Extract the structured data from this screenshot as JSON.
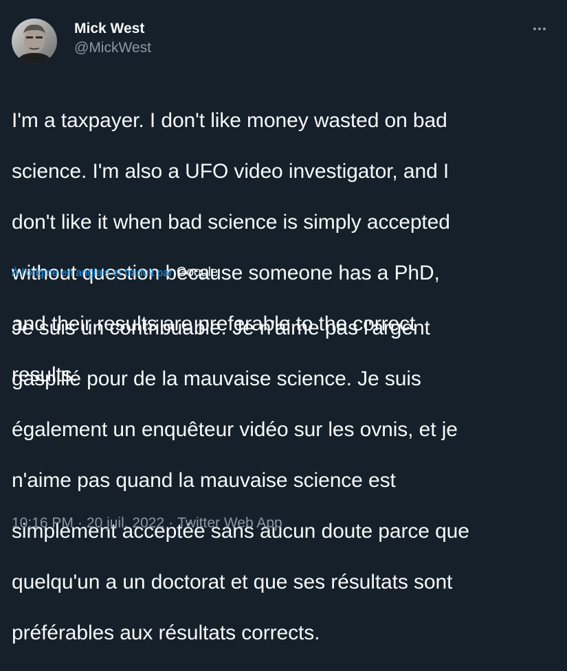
{
  "author": {
    "display_name": "Mick West",
    "handle": "@MickWest",
    "avatar_icon": "user-avatar"
  },
  "menu": {
    "icon": "more-options-icon"
  },
  "tweet": {
    "original_lines": [
      "I'm a taxpayer. I don't like money wasted on bad",
      "science. I'm also a UFO video investigator, and I",
      "don't like it when bad science is simply accepted",
      "without question because someone has a PhD,",
      "and their results are preferable to the correct",
      "results."
    ],
    "translation_note": "À l'origine en anglais et traduit par",
    "translation_provider": "Google",
    "translated_lines": [
      "Je suis un contribuable. Je n'aime pas l'argent",
      "gaspillé pour de la mauvaise science. Je suis",
      "également un enquêteur vidéo sur les ovnis, et je",
      "n'aime pas quand la mauvaise science est",
      "simplement acceptée sans aucun doute parce que",
      "quelqu'un a un doctorat et que ses résultats sont",
      "préférables aux résultats corrects."
    ]
  },
  "meta": {
    "time": "10:16 PM",
    "separator1": "·",
    "date": "20 juil. 2022",
    "separator2": "·",
    "source": "Twitter Web App"
  },
  "colors": {
    "background": "#15202b",
    "text": "#f7f9f9",
    "secondary": "#8b98a5",
    "link": "#1d9bf0"
  }
}
